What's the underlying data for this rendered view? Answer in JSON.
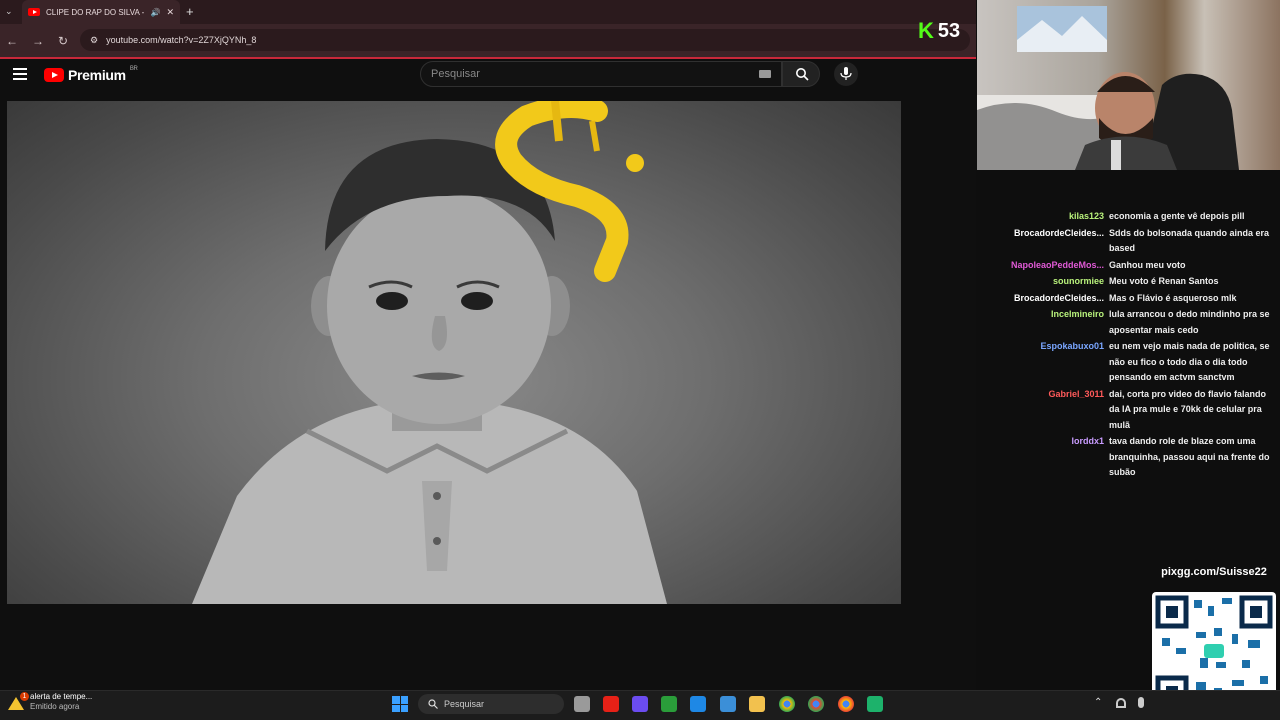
{
  "browser": {
    "tab_title": "CLIPE DO RAP DO SILVA - |",
    "url": "youtube.com/watch?v=2Z7XjQYNh_8"
  },
  "youtube": {
    "logo_text": "Premium",
    "logo_badge": "BR",
    "search_placeholder": "Pesquisar"
  },
  "stream_overlay": {
    "counter": "53",
    "counter_logo": "K",
    "pix_url": "pixgg.com/Suisse22"
  },
  "chat": {
    "messages": [
      {
        "user": "kilas123",
        "color": "#b9f27c",
        "text": "economia a gente vê depois pill"
      },
      {
        "user": "BrocadordeCleides...",
        "color": "#ffffff",
        "text": "Sdds do bolsonada quando ainda era based"
      },
      {
        "user": "NapoleaoPeddeMos...",
        "color": "#e05ad6",
        "text": "Ganhou meu voto"
      },
      {
        "user": "sounormiee",
        "color": "#b9f27c",
        "text": "Meu voto é Renan Santos"
      },
      {
        "user": "BrocadordeCleides...",
        "color": "#ffffff",
        "text": "Mas o Flávio é asqueroso mlk"
      },
      {
        "user": "Incelmineiro",
        "color": "#b9f27c",
        "text": "lula arrancou o dedo mindinho pra se aposentar mais cedo"
      },
      {
        "user": "Espokabuxo01",
        "color": "#7aa6ff",
        "text": "eu nem vejo mais nada de politica, se não eu fico o todo dia o dia todo pensando em actvm sanctvm"
      },
      {
        "user": "Gabriel_3011",
        "color": "#ff5a5a",
        "text": "dai, corta pro video do flavio falando da IA pra mule e 70kk de celular pra mulã"
      },
      {
        "user": "lorddx1",
        "color": "#c99cff",
        "text": "tava dando role de blaze com uma branquinha, passou aqui na frente do subão"
      }
    ]
  },
  "taskbar": {
    "notification_title": "alerta de tempe...",
    "notification_sub": "Emitido agora",
    "notification_count": "1",
    "search_placeholder": "Pesquisar"
  }
}
